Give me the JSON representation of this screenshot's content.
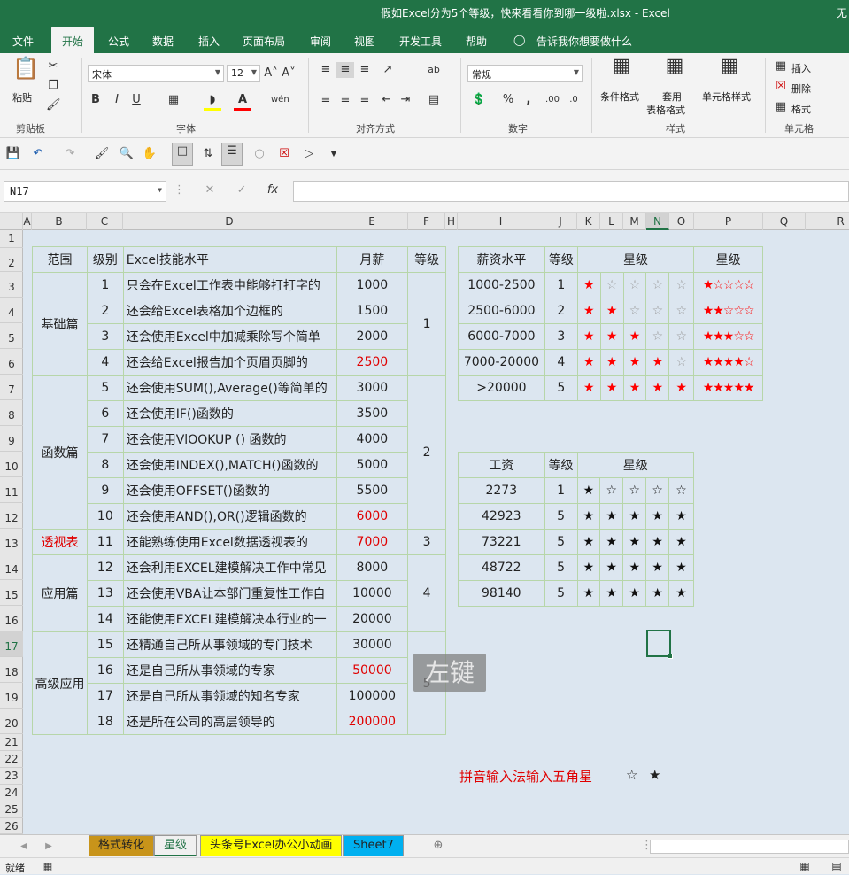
{
  "window": {
    "title": "假如Excel分为5个等级，快来看看你到哪一级啦.xlsx  -  Excel",
    "title_extra": "无"
  },
  "menu": {
    "tabs": [
      "文件",
      "开始",
      "公式",
      "数据",
      "插入",
      "页面布局",
      "审阅",
      "视图",
      "开发工具",
      "帮助",
      "告诉我你想要做什么"
    ]
  },
  "ribbon": {
    "clipboard": {
      "paste": "粘贴",
      "label": "剪贴板"
    },
    "font": {
      "name": "宋体",
      "size": "12",
      "label": "字体",
      "bold": "B",
      "italic": "I",
      "underline": "U"
    },
    "alignment": {
      "label": "对齐方式"
    },
    "number": {
      "format": "常规",
      "label": "数字"
    },
    "styles": {
      "conditional": "条件格式",
      "table": "套用",
      "table2": "表格格式",
      "cell": "单元格样式",
      "label": "样式"
    },
    "cells": {
      "insert": "插入",
      "delete": "删除",
      "format": "格式",
      "label": "单元格"
    }
  },
  "formula": {
    "namebox": "N17",
    "fx": "fx"
  },
  "columns": [
    "A",
    "B",
    "C",
    "D",
    "E",
    "F",
    "H",
    "I",
    "J",
    "K",
    "L",
    "M",
    "N",
    "O",
    "P",
    "Q",
    "R"
  ],
  "rows": [
    "1",
    "2",
    "3",
    "4",
    "5",
    "6",
    "7",
    "8",
    "9",
    "10",
    "11",
    "12",
    "13",
    "14",
    "15",
    "16",
    "17",
    "18",
    "19",
    "20",
    "21",
    "22",
    "23",
    "24",
    "25",
    "26"
  ],
  "table1": {
    "headers": [
      "范围",
      "级别",
      "Excel技能水平",
      "月薪",
      "等级"
    ],
    "groups": [
      {
        "name": "基础篇",
        "grade": "1",
        "red": false,
        "rows": [
          {
            "lvl": "1",
            "desc": "只会在Excel工作表中能够打打字的",
            "pay": "1000",
            "red": false
          },
          {
            "lvl": "2",
            "desc": "还会给Excel表格加个边框的",
            "pay": "1500",
            "red": false
          },
          {
            "lvl": "3",
            "desc": "还会使用Excel中加减乘除写个简单",
            "pay": "2000",
            "red": false
          },
          {
            "lvl": "4",
            "desc": "还会给Excel报告加个页眉页脚的",
            "pay": "2500",
            "red": true
          }
        ]
      },
      {
        "name": "函数篇",
        "grade": "2",
        "red": false,
        "rows": [
          {
            "lvl": "5",
            "desc": "还会使用SUM(),Average()等简单的",
            "pay": "3000",
            "red": false
          },
          {
            "lvl": "6",
            "desc": "还会使用IF()函数的",
            "pay": "3500",
            "red": false
          },
          {
            "lvl": "7",
            "desc": "还会使用VlOOKUP () 函数的",
            "pay": "4000",
            "red": false
          },
          {
            "lvl": "8",
            "desc": "还会使用INDEX(),MATCH()函数的",
            "pay": "5000",
            "red": false
          },
          {
            "lvl": "9",
            "desc": "还会使用OFFSET()函数的",
            "pay": "5500",
            "red": false
          },
          {
            "lvl": "10",
            "desc": "还会使用AND(),OR()逻辑函数的",
            "pay": "6000",
            "red": true
          }
        ]
      },
      {
        "name": "透视表",
        "grade": "3",
        "red": true,
        "rows": [
          {
            "lvl": "11",
            "desc": "还能熟练使用Excel数据透视表的",
            "pay": "7000",
            "red": true
          }
        ]
      },
      {
        "name": "应用篇",
        "grade": "4",
        "red": false,
        "rows": [
          {
            "lvl": "12",
            "desc": "还会利用EXCEL建模解决工作中常见",
            "pay": "8000",
            "red": false
          },
          {
            "lvl": "13",
            "desc": "还会使用VBA让本部门重复性工作自",
            "pay": "10000",
            "red": false
          },
          {
            "lvl": "14",
            "desc": "还能使用EXCEL建模解决本行业的一",
            "pay": "20000",
            "red": false
          }
        ]
      },
      {
        "name": "高级应用",
        "grade": "5",
        "red": false,
        "rows": [
          {
            "lvl": "15",
            "desc": "还精通自己所从事领域的专门技术",
            "pay": "30000",
            "red": false
          },
          {
            "lvl": "16",
            "desc": "还是自己所从事领域的专家",
            "pay": "50000",
            "red": true
          },
          {
            "lvl": "17",
            "desc": "还是自己所从事领域的知名专家",
            "pay": "100000",
            "red": false
          },
          {
            "lvl": "18",
            "desc": "还是所在公司的高层领导的",
            "pay": "200000",
            "red": true
          }
        ]
      }
    ]
  },
  "table2": {
    "headers": [
      "薪资水平",
      "等级",
      "星级",
      "星级"
    ],
    "rows": [
      {
        "range": "1000-2500",
        "grade": "1",
        "stars": "★☆☆☆☆"
      },
      {
        "range": "2500-6000",
        "grade": "2",
        "stars": "★★☆☆☆"
      },
      {
        "range": "6000-7000",
        "grade": "3",
        "stars": "★★★☆☆"
      },
      {
        "range": "7000-20000",
        "grade": "4",
        "stars": "★★★★☆"
      },
      {
        "range": ">20000",
        "grade": "5",
        "stars": "★★★★★"
      }
    ]
  },
  "table3": {
    "headers": [
      "工资",
      "等级",
      "星级"
    ],
    "rows": [
      {
        "pay": "2273",
        "grade": "1",
        "stars": "★☆☆☆☆"
      },
      {
        "pay": "42923",
        "grade": "5",
        "stars": "★★★★★"
      },
      {
        "pay": "73221",
        "grade": "5",
        "stars": "★★★★★"
      },
      {
        "pay": "48722",
        "grade": "5",
        "stars": "★★★★★"
      },
      {
        "pay": "98140",
        "grade": "5",
        "stars": "★★★★★"
      }
    ]
  },
  "overlay": "左键",
  "note": {
    "text": "拼音输入法输入五角星",
    "s1": "☆",
    "s2": "★"
  },
  "sheets": [
    {
      "name": "格式转化",
      "bg": "#c8941a"
    },
    {
      "name": "星级",
      "bg": "#f0f0f0"
    },
    {
      "name": "头条号Excel办公小动画",
      "bg": "#ffff00"
    },
    {
      "name": "Sheet7",
      "bg": "#00b0f0"
    }
  ],
  "status": {
    "ready": "就绪"
  }
}
